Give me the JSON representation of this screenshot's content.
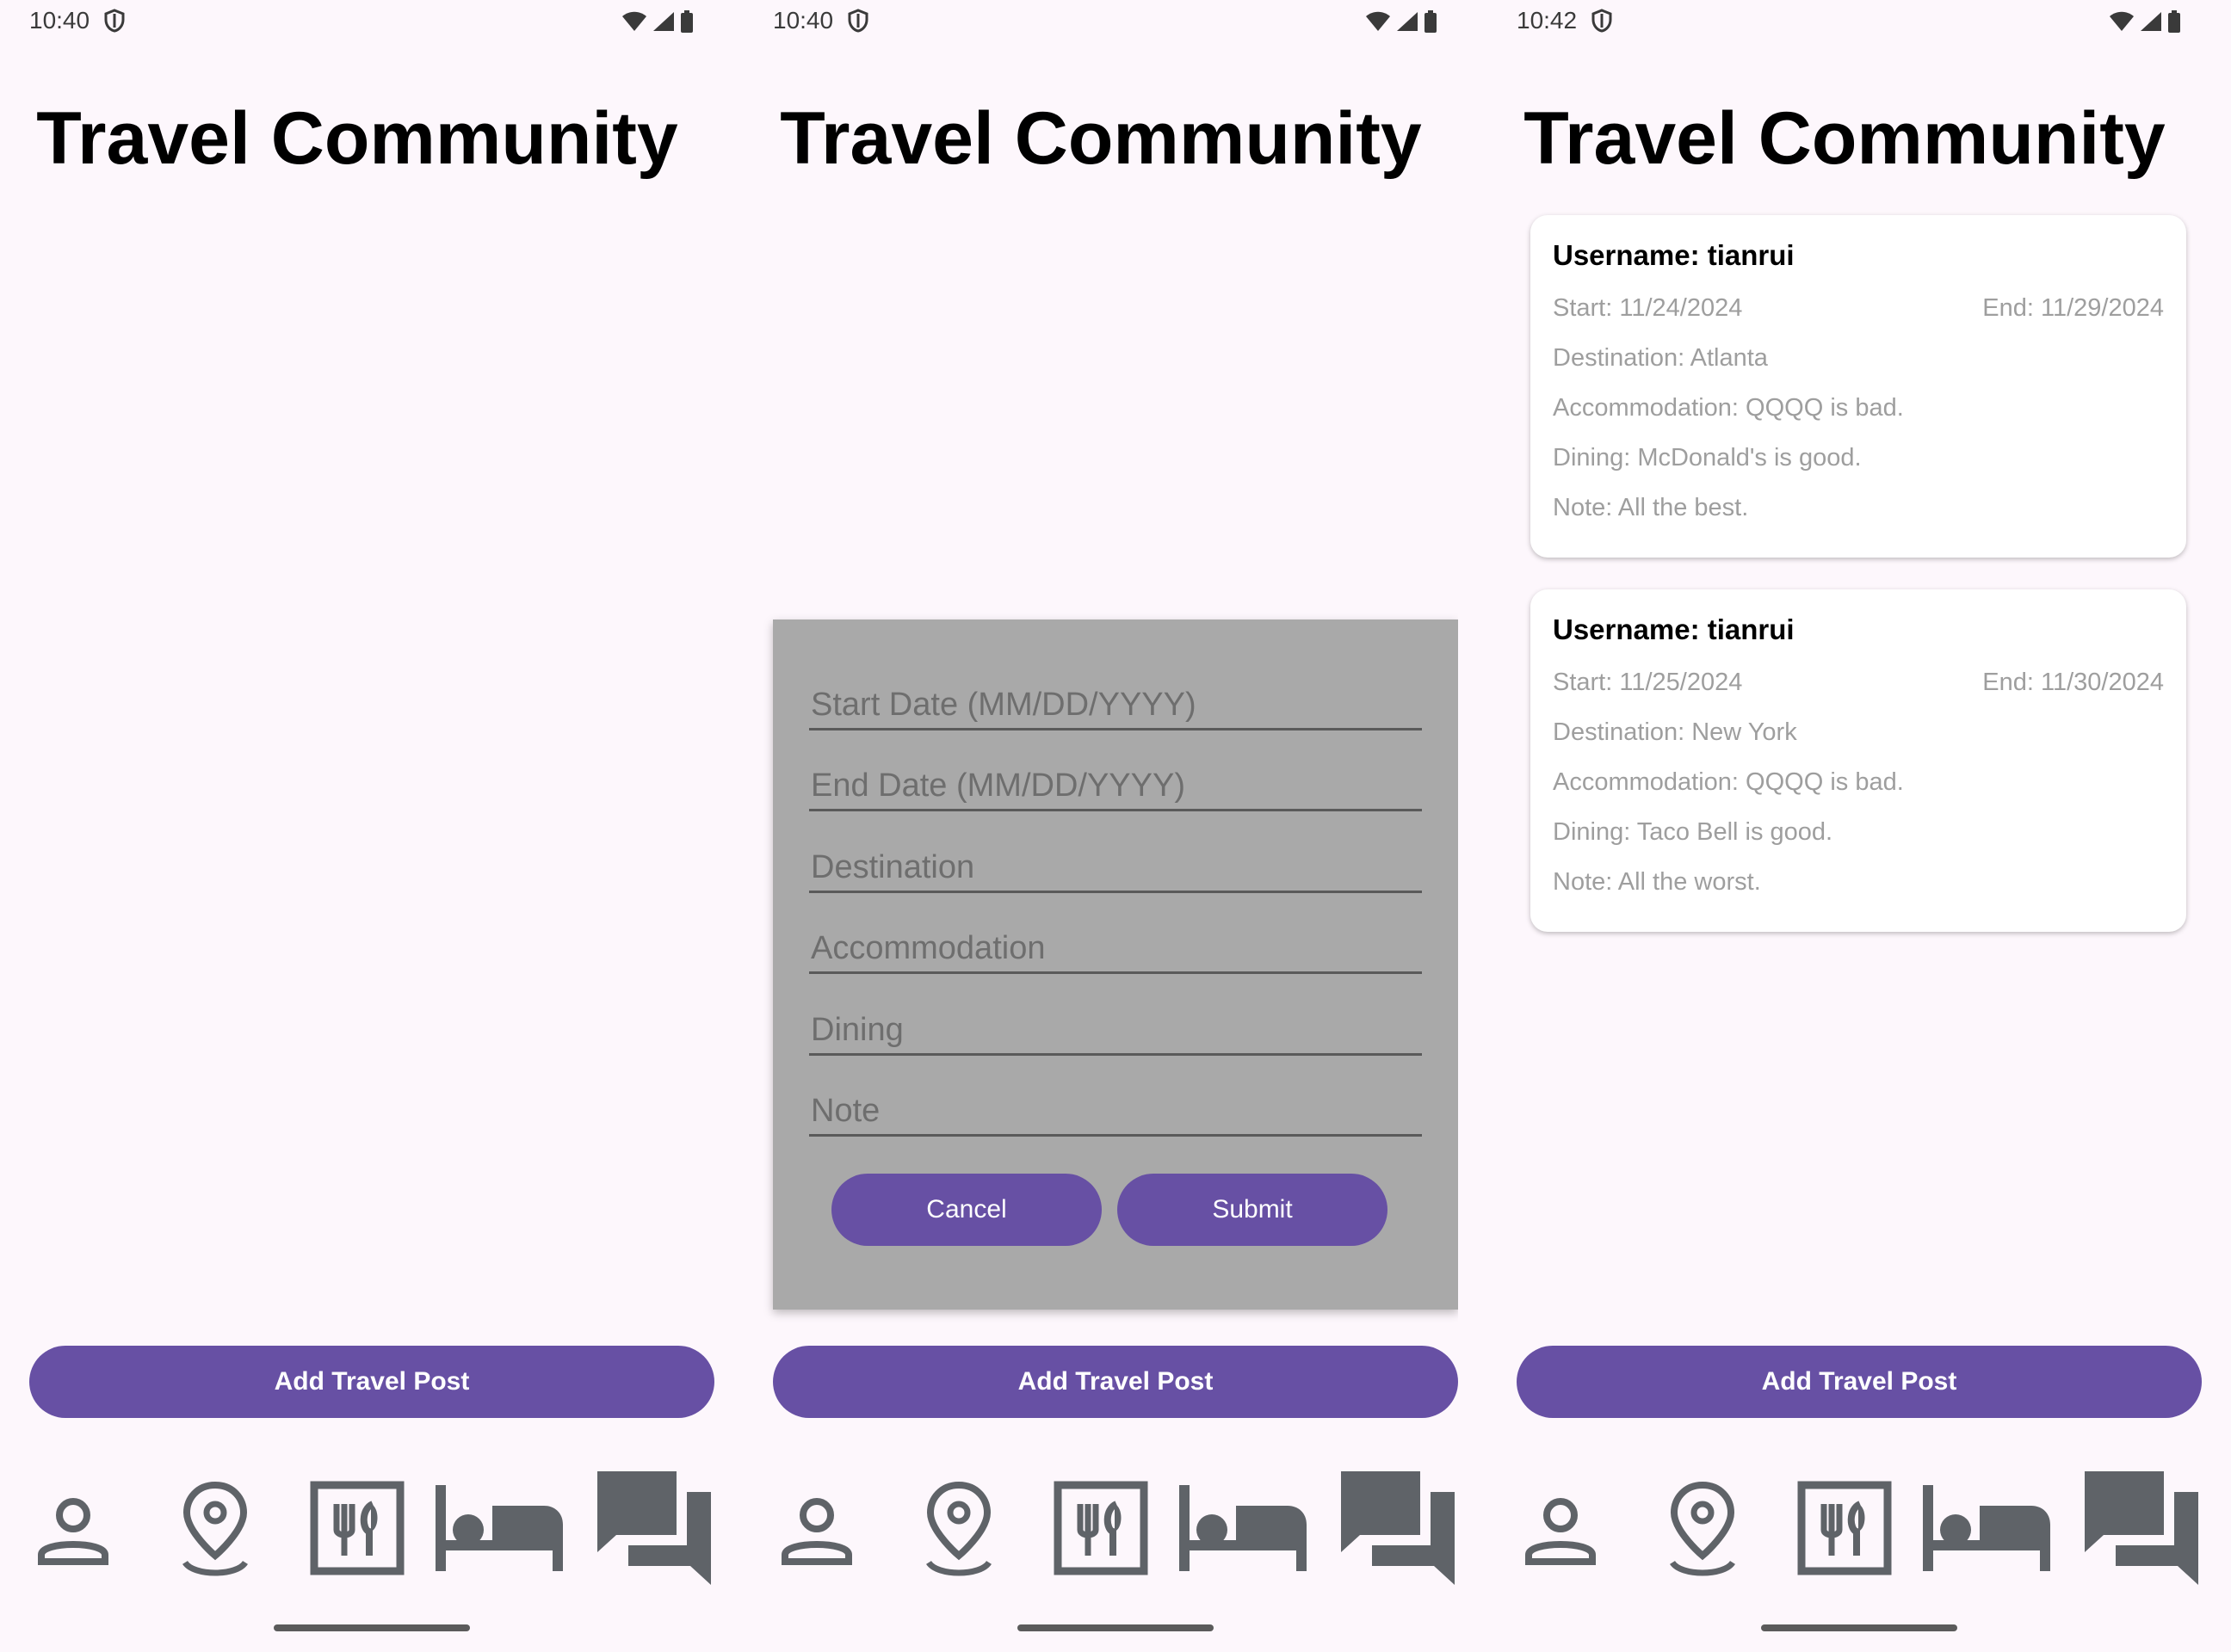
{
  "screens": [
    {
      "status_time": "10:40",
      "title": "Travel Community",
      "add_button": "Add Travel Post"
    },
    {
      "status_time": "10:40",
      "title": "Travel Community",
      "add_button": "Add Travel Post",
      "dialog": {
        "fields": [
          "Start Date (MM/DD/YYYY)",
          "End Date (MM/DD/YYYY)",
          "Destination",
          "Accommodation",
          "Dining",
          "Note"
        ],
        "cancel": "Cancel",
        "submit": "Submit"
      }
    },
    {
      "status_time": "10:42",
      "title": "Travel Community",
      "add_button": "Add Travel Post",
      "posts": [
        {
          "username": "Username: tianrui",
          "start": "Start: 11/24/2024",
          "end": "End: 11/29/2024",
          "destination": "Destination: Atlanta",
          "accommodation": "Accommodation: QQQQ is bad.",
          "dining": "Dining: McDonald's is good.",
          "note": "Note: All the best."
        },
        {
          "username": "Username: tianrui",
          "start": "Start: 11/25/2024",
          "end": "End: 11/30/2024",
          "destination": "Destination: New York",
          "accommodation": "Accommodation: QQQQ is bad.",
          "dining": "Dining: Taco Bell is good.",
          "note": "Note: All the worst."
        }
      ]
    }
  ],
  "nav_icons": [
    "profile-icon",
    "location-pin-icon",
    "restaurant-icon",
    "hotel-bed-icon",
    "forum-icon"
  ],
  "colors": {
    "background": "#fdf7fc",
    "primary": "#6750a4",
    "dialog_bg": "#a9a9a9",
    "nav_icon": "#5f6368"
  }
}
